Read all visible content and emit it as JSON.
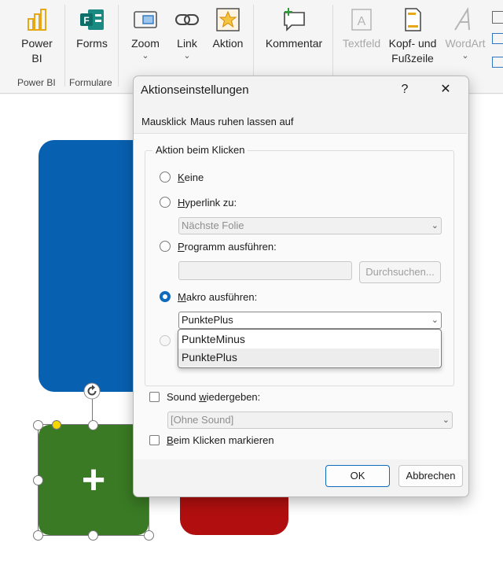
{
  "ribbon": {
    "buttons": [
      {
        "label": "Power BI",
        "chevron": false
      },
      {
        "label": "Forms",
        "chevron": false
      },
      {
        "label": "Zoom",
        "chevron": true
      },
      {
        "label": "Link",
        "chevron": true
      },
      {
        "label": "Aktion",
        "chevron": false
      },
      {
        "label": "Kommentar",
        "chevron": false
      },
      {
        "label": "Textfeld",
        "chevron": false
      },
      {
        "label": "Kopf- und Fußzeile",
        "chevron": false
      },
      {
        "label": "WordArt",
        "chevron": true
      }
    ],
    "groups": [
      "Power BI",
      "Formulare"
    ]
  },
  "slide": {
    "shapes": [
      {
        "name": "blue-shape",
        "color": "#0860b0"
      },
      {
        "name": "green-shape",
        "color": "#3a7a24",
        "symbol": "+"
      },
      {
        "name": "red-shape",
        "color": "#b10f0f"
      }
    ]
  },
  "dialog": {
    "title": "Aktionseinstellungen",
    "help": "?",
    "close": "✕",
    "tabs": [
      "Mausklick",
      "Maus ruhen lassen auf"
    ],
    "group_label": "Aktion beim Klicken",
    "options": {
      "none": {
        "pre": "",
        "u": "K",
        "post": "eine"
      },
      "hyperlink": {
        "pre": "",
        "u": "H",
        "post": "yperlink zu:"
      },
      "program": {
        "pre": "",
        "u": "P",
        "post": "rogramm ausführen:"
      },
      "macro": {
        "pre": "",
        "u": "M",
        "post": "akro ausführen:"
      }
    },
    "hyperlink_value": "Nächste Folie",
    "program_value": "",
    "browse_button": "Durchsuchen...",
    "macro_value": "PunktePlus",
    "macro_options": [
      "PunkteMinus",
      "PunktePlus"
    ],
    "selected_option": "macro",
    "sound": {
      "pre": "Sound ",
      "u": "w",
      "post": "iedergeben:"
    },
    "sound_value": "[Ohne Sound]",
    "highlight": {
      "pre": "",
      "u": "B",
      "post": "eim Klicken markieren"
    },
    "ok_button": "OK",
    "cancel_button": "Abbrechen"
  },
  "colors": {
    "accent": "#0f6cbd"
  }
}
